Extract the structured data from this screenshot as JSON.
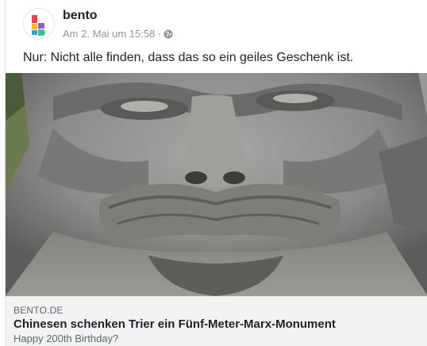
{
  "post": {
    "author": "bento",
    "timestamp": "Am 2. Mai um 15:58",
    "separator": "·",
    "audience_icon": "globe-icon",
    "text": "Nur: Nicht alle finden, dass das so ein geiles Geschenk ist."
  },
  "link": {
    "domain": "BENTO.DE",
    "title": "Chinesen schenken Trier ein Fünf-Meter-Marx-Monument",
    "description": "Happy 200th Birthday?"
  },
  "colors": {
    "logo_red": "#e8424e",
    "logo_yellow": "#f6b733",
    "logo_blue": "#3aa0dd",
    "logo_purple": "#9b59d0",
    "logo_green": "#39c08e"
  }
}
